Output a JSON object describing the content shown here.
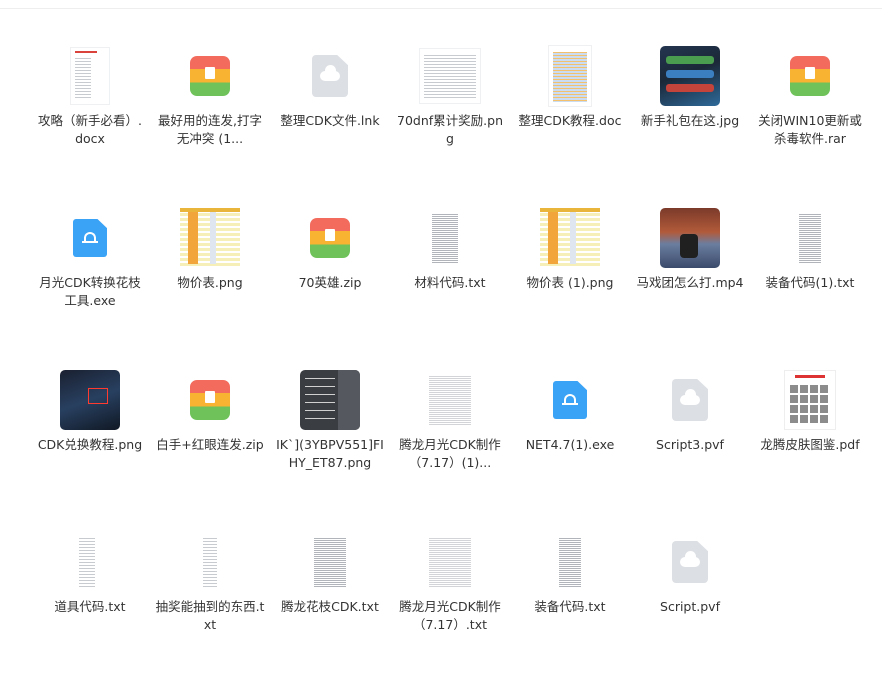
{
  "files": [
    {
      "name": "攻略（新手必看）.docx",
      "icon": "docx-preview-icon"
    },
    {
      "name": "最好用的连发,打字无冲突 (1...",
      "icon": "zip-archive-icon"
    },
    {
      "name": "整理CDK文件.lnk",
      "icon": "generic-file-icon"
    },
    {
      "name": "70dnf累计奖励.png",
      "icon": "image-preview-icon"
    },
    {
      "name": "整理CDK教程.doc",
      "icon": "doc-preview-icon"
    },
    {
      "name": "新手礼包在这.jpg",
      "icon": "image-preview-icon"
    },
    {
      "name": "关闭WIN10更新或杀毒软件.rar",
      "icon": "rar-archive-icon"
    },
    {
      "name": "月光CDK转换花枝工具.exe",
      "icon": "exe-app-icon"
    },
    {
      "name": "物价表.png",
      "icon": "image-preview-icon"
    },
    {
      "name": "70英雄.zip",
      "icon": "zip-archive-icon"
    },
    {
      "name": "材料代码.txt",
      "icon": "txt-preview-icon"
    },
    {
      "name": "物价表 (1).png",
      "icon": "image-preview-icon"
    },
    {
      "name": "马戏团怎么打.mp4",
      "icon": "video-preview-icon"
    },
    {
      "name": "装备代码(1).txt",
      "icon": "txt-preview-icon"
    },
    {
      "name": "CDK兑换教程.png",
      "icon": "image-preview-icon"
    },
    {
      "name": "白手+红眼连发.zip",
      "icon": "zip-archive-icon"
    },
    {
      "name": "IK`](3YBPV551]FIHY_ET87.png",
      "icon": "image-preview-icon"
    },
    {
      "name": "腾龙月光CDK制作（7.17）(1)...",
      "icon": "txt-preview-icon"
    },
    {
      "name": "NET4.7(1).exe",
      "icon": "exe-app-icon"
    },
    {
      "name": "Script3.pvf",
      "icon": "generic-file-icon"
    },
    {
      "name": "龙腾皮肤图鉴.pdf",
      "icon": "pdf-preview-icon"
    },
    {
      "name": "道具代码.txt",
      "icon": "txt-preview-icon"
    },
    {
      "name": "抽奖能抽到的东西.txt",
      "icon": "txt-preview-icon"
    },
    {
      "name": "腾龙花枝CDK.txt",
      "icon": "txt-preview-icon"
    },
    {
      "name": "腾龙月光CDK制作（7.17）.txt",
      "icon": "txt-preview-icon"
    },
    {
      "name": "装备代码.txt",
      "icon": "txt-preview-icon"
    },
    {
      "name": "Script.pvf",
      "icon": "generic-file-icon"
    }
  ]
}
